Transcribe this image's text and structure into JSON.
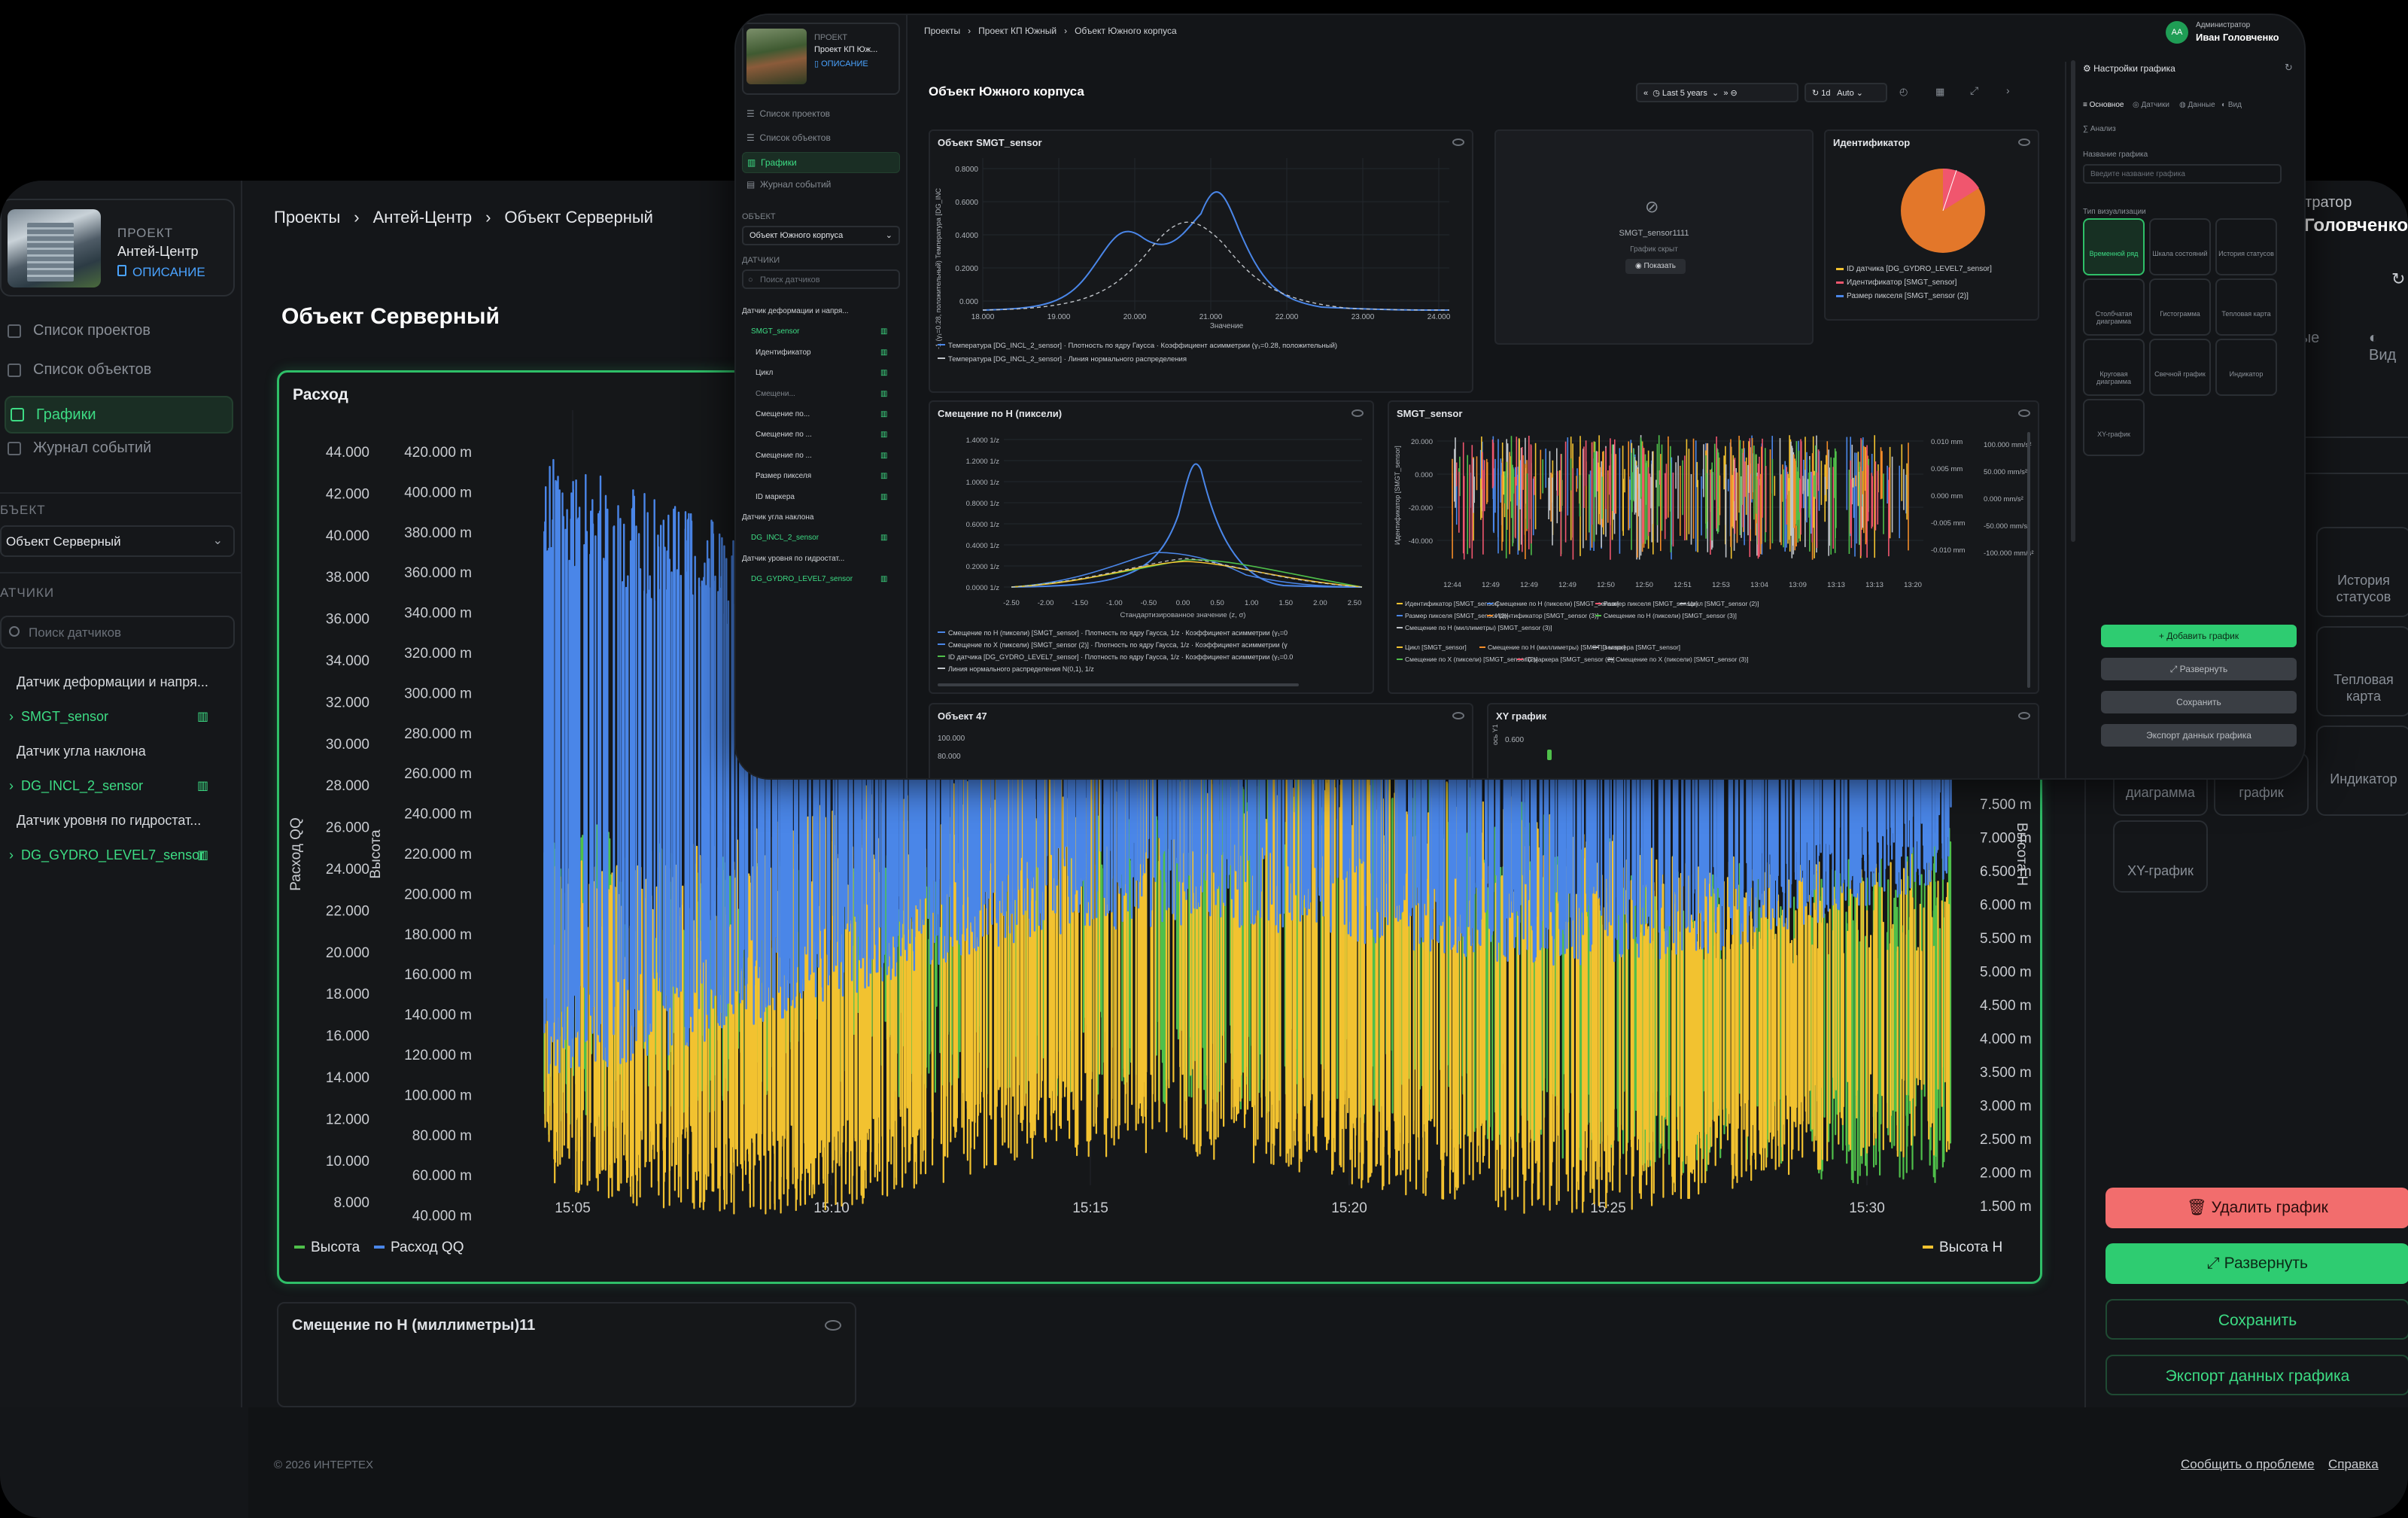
{
  "back": {
    "project": {
      "label": "ПРОЕКТ",
      "name": "Антей-Центр",
      "desc": "ОПИСАНИЕ"
    },
    "nav": [
      "Список проектов",
      "Список объектов",
      "Графики",
      "Журнал событий"
    ],
    "object_label": "БЪЕКТ",
    "object_value": "Объект Серверный",
    "sensors_label": "АТЧИКИ",
    "sensor_search": "Поиск датчиков",
    "tree": [
      "Датчик деформации и напря...",
      "SMGT_sensor",
      "Датчик угла наклона",
      "DG_INCL_2_sensor",
      "Датчик уровня по гидростат...",
      "DG_GYDRO_LEVEL7_sensor"
    ],
    "breadcrumbs": [
      "Проекты",
      "Антей-Центр",
      "Объект Серверный"
    ],
    "title": "Объект Серверный",
    "panel2_title": "Смещение по H (миллиметры)11",
    "right": {
      "admin": "истратор",
      "user": "Головченко",
      "tab_data": "Данные",
      "tab_view": "Вид",
      "tiles": [
        "История статусов",
        "Тепловая карта",
        "Индикатор",
        "диаграмма",
        "график",
        "XY-график"
      ],
      "buttons": [
        "Удалить график",
        "Развернуть",
        "Сохранить",
        "Экспорт данных графика"
      ]
    },
    "footer": {
      "copy": "© 2026 ИНТЕРТЕХ",
      "report": "Сообщить о проблеме",
      "help": "Справка"
    }
  },
  "chart_data": {
    "type": "line",
    "title": "Расход",
    "left_axis": {
      "label": "Расход QQ",
      "ticks": [
        "44.000",
        "42.000",
        "40.000",
        "38.000",
        "36.000",
        "34.000",
        "32.000",
        "30.000",
        "28.000",
        "26.000",
        "24.000",
        "22.000",
        "20.000",
        "18.000",
        "16.000",
        "14.000",
        "12.000",
        "10.000",
        "8.000"
      ]
    },
    "left_axis2": {
      "label": "Высота",
      "ticks": [
        "420.000 m",
        "400.000 m",
        "380.000 m",
        "360.000 m",
        "340.000 m",
        "320.000 m",
        "300.000 m",
        "280.000 m",
        "260.000 m",
        "240.000 m",
        "220.000 m",
        "200.000 m",
        "180.000 m",
        "160.000 m",
        "140.000 m",
        "120.000 m",
        "100.000 m",
        "80.000 m",
        "60.000 m",
        "40.000 m"
      ]
    },
    "right_axis": {
      "label": "Высота H",
      "ticks": [
        "7.500 m",
        "7.000 m",
        "6.500 m",
        "6.000 m",
        "5.500 m",
        "5.000 m",
        "4.500 m",
        "4.000 m",
        "3.500 m",
        "3.000 m",
        "2.500 m",
        "2.000 m",
        "1.500 m"
      ]
    },
    "x_ticks": [
      "15:05",
      "15:10",
      "15:15",
      "15:20",
      "15:25",
      "15:30"
    ],
    "series": [
      {
        "name": "Высота",
        "color": "#4fbf4a"
      },
      {
        "name": "Расход QQ",
        "color": "#4a86e8"
      },
      {
        "name": "Высота H",
        "color": "#f2c230"
      }
    ]
  },
  "front": {
    "project": {
      "label": "ПРОЕКТ",
      "name": "Проект КП Юж...",
      "desc": "ОПИСАНИЕ"
    },
    "nav": [
      "Список проектов",
      "Список объектов",
      "Графики",
      "Журнал событий"
    ],
    "object_label": "ОБЪЕКТ",
    "object_value": "Объект Южного корпуса",
    "sensors_label": "ДАТЧИКИ",
    "sensor_search": "Поиск датчиков",
    "tree": [
      "Датчик деформации и напря...",
      "SMGT_sensor",
      "Идентификатор",
      "Цикл",
      "Смещени...",
      "Смещение по...",
      "Смещение по ...",
      "Смещение по ...",
      "Размер пикселя",
      "ID маркера",
      "Датчик угла наклона",
      "DG_INCL_2_sensor",
      "Датчик уровня по гидростат...",
      "DG_GYDRO_LEVEL7_sensor"
    ],
    "breadcrumbs": [
      "Проекты",
      "Проект КП Южный",
      "Объект Южного корпуса"
    ],
    "user": {
      "initials": "АА",
      "role": "Администратор",
      "name": "Иван Головченко"
    },
    "title": "Объект Южного корпуса",
    "toolbar": {
      "range": "Last 5 years",
      "interval": "1d",
      "mode": "Auto"
    },
    "panels": {
      "p1": {
        "title": "Объект SMGT_sensor",
        "xlabel": "Значение",
        "ylabel": "-1 (γ₁=0.28, положительный) Температура [DG_INC",
        "yticks": [
          "0.8000",
          "0.6000",
          "0.4000",
          "0.2000",
          "0.000"
        ],
        "xticks": [
          "18.000",
          "19.000",
          "20.000",
          "21.000",
          "22.000",
          "23.000",
          "24.000"
        ],
        "legend": [
          "Температура [DG_INCL_2_sensor] · Плотность по ядру Гаусса · Коэффициент асимметрии (γ₁=0.28, положительный)",
          "Температура [DG_INCL_2_sensor] · Линия нормального распределения"
        ]
      },
      "p2": {
        "hidden_name": "SMGT_sensor1111",
        "hidden_text": "График скрыт",
        "show": "Показать"
      },
      "p3": {
        "title": "Идентификатор",
        "legend": [
          "ID датчика [DG_GYDRO_LEVEL7_sensor]",
          "Идентификатор [SMGT_sensor]",
          "Размер пикселя [SMGT_sensor (2)]"
        ]
      },
      "p4": {
        "title": "Смещение по H (пиксели)",
        "xlabel": "Стандартизированное значение (z, σ)",
        "yticks": [
          "1.4000 1/z",
          "1.2000 1/z",
          "1.0000 1/z",
          "0.8000 1/z",
          "0.6000 1/z",
          "0.4000 1/z",
          "0.2000 1/z",
          "0.0000 1/z"
        ],
        "xticks": [
          "-2.50",
          "-2.00",
          "-1.50",
          "-1.00",
          "-0.50",
          "0.00",
          "0.50",
          "1.00",
          "1.50",
          "2.00",
          "2.50"
        ],
        "legend": [
          "Смещение по H (пиксели) [SMGT_sensor] · Плотность по ядру Гаусса, 1/z · Коэффициент асимметрии (γ₁=0",
          "Смещение по X (пиксели) [SMGT_sensor (2)] · Плотность по ядру Гаусса, 1/z · Коэффициент асимметрии (γ",
          "ID датчика [DG_GYDRO_LEVEL7_sensor] · Плотность по ядру Гаусса, 1/z · Коэффициент асимметрии (γ₁=0.0",
          "Линия нормального распределения N(0,1), 1/z"
        ]
      },
      "p5": {
        "title": "SMGT_sensor",
        "ylabel": "Идентификатор [SMGT_sensor]",
        "yticks": [
          "20.000",
          "0.000",
          "-20.000",
          "-40.000"
        ],
        "r1ticks": [
          "0.010 mm",
          "0.005 mm",
          "0.000 mm",
          "-0.005 mm",
          "-0.010 mm"
        ],
        "r2ticks": [
          "100.000 mm/s²",
          "50.000 mm/s²",
          "0.000 mm/s²",
          "-50.000 mm/s²",
          "-100.000 mm/s²"
        ],
        "xticks": [
          "12:44",
          "12:49",
          "12:49",
          "12:49",
          "12:50",
          "12:50",
          "12:51",
          "12:53",
          "13:04",
          "13:09",
          "13:13",
          "13:13",
          "13:20"
        ],
        "legend": [
          "Идентификатор [SMGT_sensor]",
          "Смещение по H (пиксели) [SMGT_sensor]",
          "Размер пикселя [SMGT_sensor]",
          "Цикл [SMGT_sensor (2)]",
          "Размер пикселя [SMGT_sensor (2)]",
          "Идентификатор [SMGT_sensor (3)]",
          "Смещение по H (пиксели) [SMGT_sensor (3)]",
          "Смещение по H (миллиметры) [SMGT_sensor (3)]",
          "Цикл [SMGT_sensor]",
          "Смещение по H (миллиметры) [SMGT_sensor]",
          "ID маркера [SMGT_sensor]",
          "Смещение по X (пиксели) [SMGT_sensor (2)]",
          "ID маркера [SMGT_sensor (2)]",
          "Смещение по X (пиксели) [SMGT_sensor (3)]"
        ]
      },
      "p6": {
        "title": "Объект 47",
        "yticks": [
          "100.000",
          "80.000"
        ]
      },
      "p7": {
        "title": "XY график",
        "ytick": "0.600",
        "ylabel": "ось Y1"
      }
    },
    "settings": {
      "title": "Настройки графика",
      "tabs": [
        "Основное",
        "Датчики",
        "Данные",
        "Вид",
        "Анализ"
      ],
      "name_label": "Название графика",
      "name_placeholder": "Введите название графика",
      "viz_label": "Тип визуализации",
      "tiles": [
        "Временной ряд",
        "Шкала состояний",
        "История статусов",
        "Столбчатая диаграмма",
        "Гистограмма",
        "Тепловая карта",
        "Круговая диаграмма",
        "Свечной график",
        "Индикатор",
        "XY-график"
      ],
      "buttons": [
        "Добавить график",
        "Развернуть",
        "Сохранить",
        "Экспорт данных графика"
      ]
    }
  }
}
